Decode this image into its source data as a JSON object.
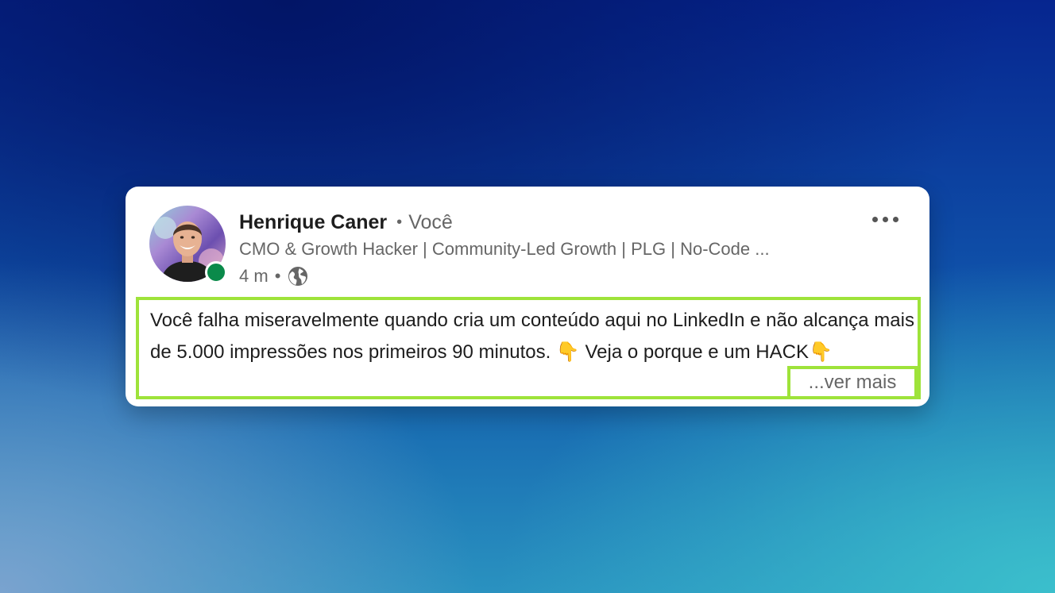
{
  "post": {
    "author": {
      "name": "Henrique Caner",
      "separator": "•",
      "degree": "Você",
      "headline": "CMO & Growth Hacker | Community-Led Growth | PLG | No-Code ...",
      "online_status_color": "#0a8a4a"
    },
    "meta": {
      "time": "4 m",
      "separator": "•",
      "visibility_icon": "globe-icon"
    },
    "more_icon": "ellipsis-icon",
    "body": {
      "text": "Você falha miseravelmente quando cria um conteúdo aqui no LinkedIn e não alcança mais de 5.000 impressões nos primeiros 90 minutos. 👇 Veja o porque e um HACK👇",
      "see_more_label": "...ver mais"
    },
    "highlight_color": "#9ee33a"
  }
}
